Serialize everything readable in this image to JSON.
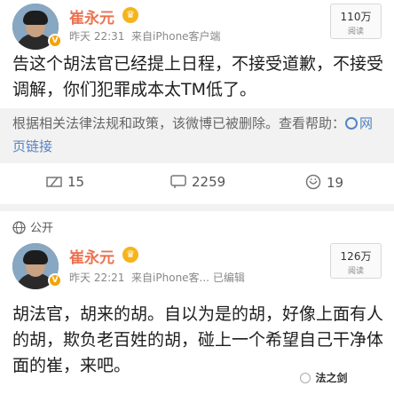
{
  "post1": {
    "author": "崔永元",
    "time": "昨天 22:31",
    "source": "来自iPhone客户端",
    "reads_count": "110万",
    "reads_label": "阅读",
    "content": "告这个胡法官已经提上日程，不接受道歉，不接受调解，你们犯罪成本太TM低了。",
    "notice": "根据相关法律法规和政策，该微博已被删除。查看帮助：",
    "notice_link": "网页链接",
    "reposts": "15",
    "comments": "2259",
    "likes": "19"
  },
  "public_label": "公开",
  "post2": {
    "author": "崔永元",
    "time": "昨天 22:21",
    "source": "来自iPhone客...",
    "edited": "已编辑",
    "reads_count": "126万",
    "reads_label": "阅读",
    "content": "胡法官，胡来的胡。自以为是的胡，好像上面有人的胡，欺负老百姓的胡，碰上一个希望自己干净体面的崔，来吧。"
  },
  "watermark": {
    "brand": "法之剑"
  },
  "colors": {
    "name": "#eb7350",
    "link": "#5583c2",
    "badge": "#f4a300"
  }
}
